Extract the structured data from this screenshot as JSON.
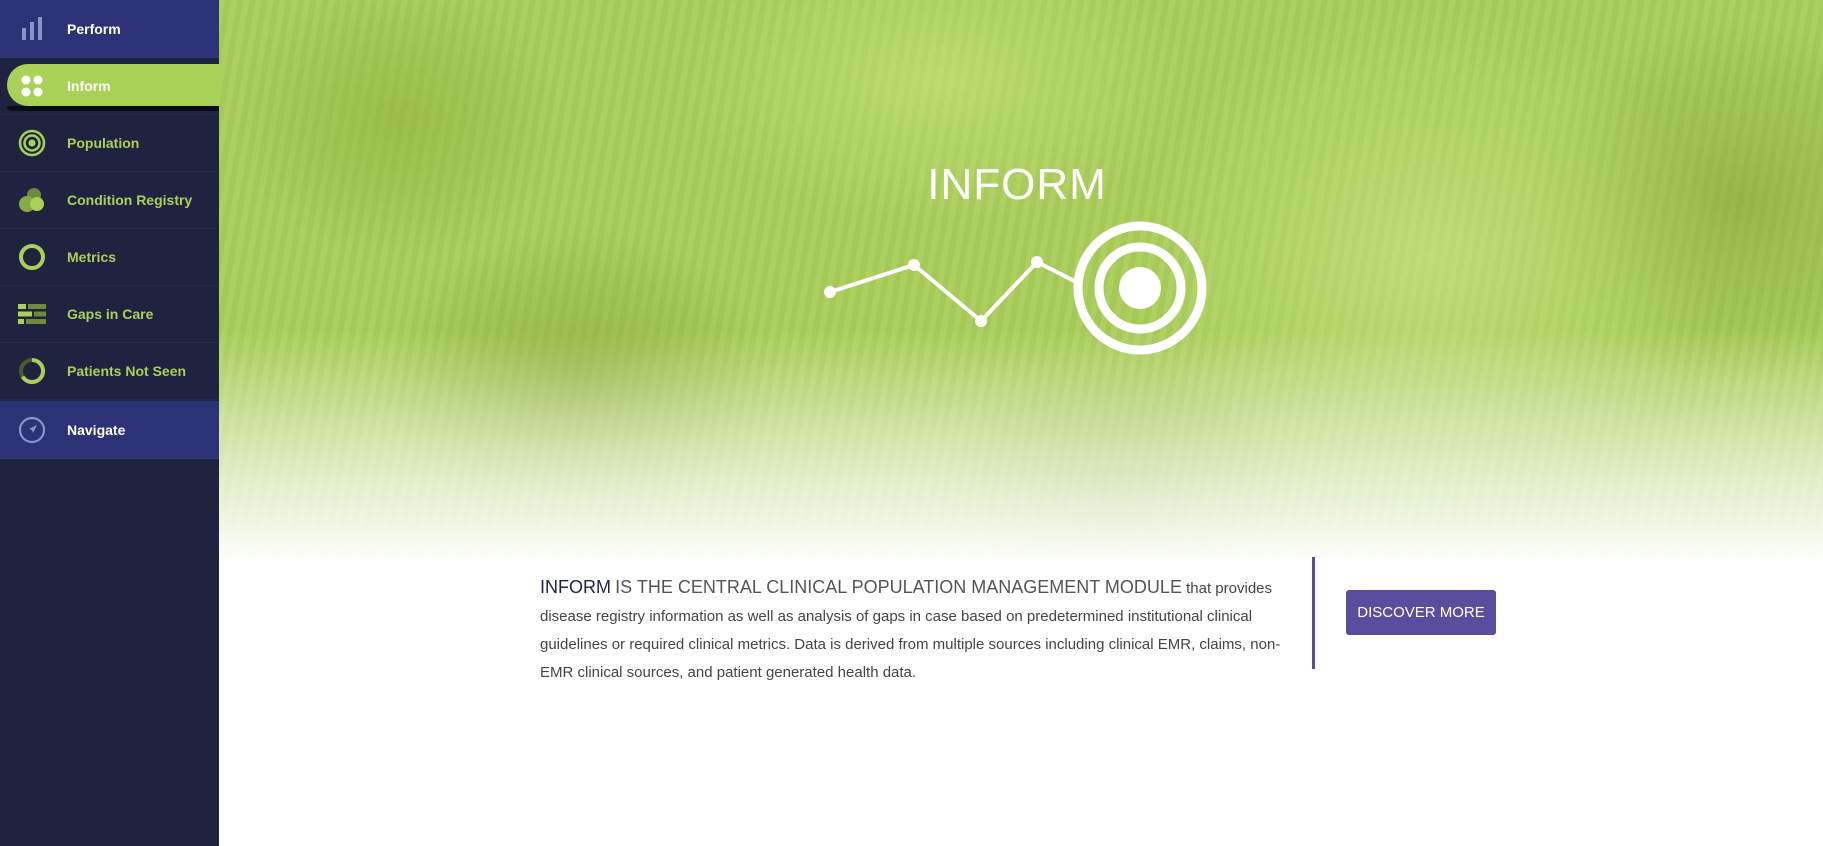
{
  "sidebar": {
    "items": [
      {
        "label": "Perform",
        "icon": "bar-chart-icon"
      },
      {
        "label": "Inform",
        "icon": "dots-grid-icon"
      },
      {
        "label": "Population",
        "icon": "target-icon"
      },
      {
        "label": "Condition Registry",
        "icon": "venn-circles-icon"
      },
      {
        "label": "Metrics",
        "icon": "ring-icon"
      },
      {
        "label": "Gaps in Care",
        "icon": "gaps-bars-icon"
      },
      {
        "label": "Patients Not Seen",
        "icon": "partial-ring-icon"
      },
      {
        "label": "Navigate",
        "icon": "compass-icon"
      }
    ],
    "active_index": 1
  },
  "hero": {
    "title": "INFORM"
  },
  "intro": {
    "lead_strong": "INFORM",
    "lead_caps": "IS THE CENTRAL CLINICAL POPULATION MANAGEMENT MODULE",
    "body": "that provides disease registry information as well as analysis of gaps in case based on predetermined institutional clinical guidelines or required clinical metrics. Data is derived from multiple sources including clinical EMR, claims, non-EMR clinical sources, and patient generated health data."
  },
  "cta": {
    "label": "DISCOVER MORE"
  },
  "colors": {
    "sidebar_bg": "#1f2340",
    "sidebar_blue": "#2b3275",
    "accent_green": "#a8d157",
    "accent_purple": "#5b4d9e"
  }
}
